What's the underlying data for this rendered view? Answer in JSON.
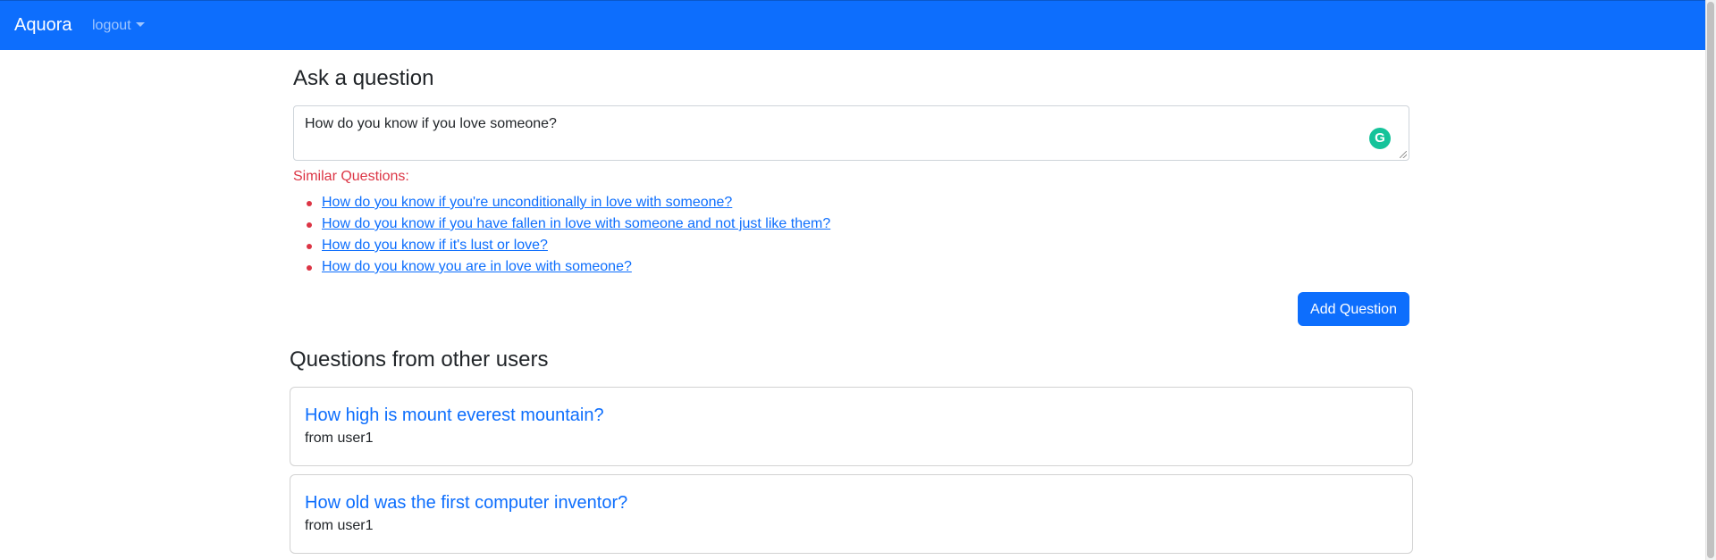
{
  "navbar": {
    "brand": "Aquora",
    "dropdown_label": "logout",
    "color": "#0d6efd"
  },
  "ask": {
    "heading": "Ask a question",
    "question_value": "How do you know if you love someone?",
    "similar_label": "Similar Questions:",
    "similar_questions": [
      "How do you know if you're unconditionally in love with someone?",
      "How do you know if you have fallen in love with someone and not just like them?",
      "How do you know if it's lust or love?",
      "How do you know you are in love with someone?"
    ],
    "add_button_label": "Add Question",
    "grammarly_icon": "grammarly-icon"
  },
  "others": {
    "heading": "Questions from other users",
    "questions": [
      {
        "title": "How high is mount everest mountain?",
        "author": "from user1"
      },
      {
        "title": "How old was the first computer inventor?",
        "author": "from user1"
      }
    ]
  },
  "colors": {
    "accent": "#0d6efd",
    "danger": "#dc3545",
    "grammarly": "#15c39a"
  }
}
